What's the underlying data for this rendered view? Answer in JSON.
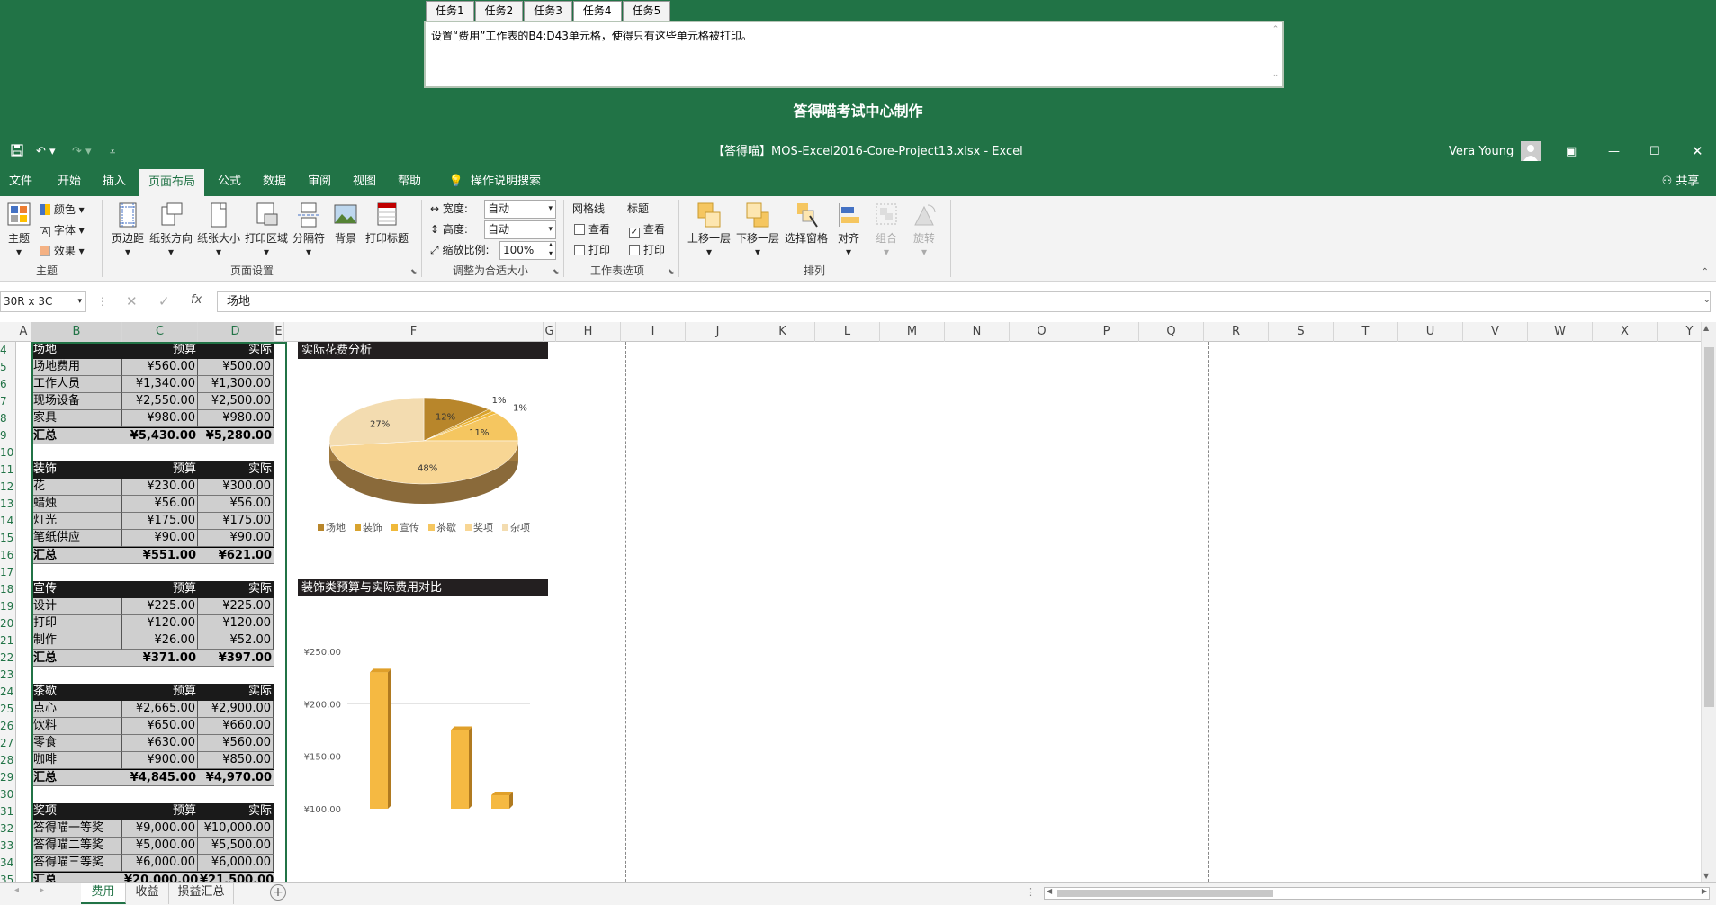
{
  "task": {
    "tabs": [
      "任务1",
      "任务2",
      "任务3",
      "任务4",
      "任务5"
    ],
    "active_tab": "任务4",
    "text": "设置“费用”工作表的B4:D43单元格，使得只有这些单元格被打印。",
    "brand": "答得喵考试中心制作"
  },
  "window": {
    "title": "【答得喵】MOS-Excel2016-Core-Project13.xlsx  -  Excel",
    "user": "Vera Young"
  },
  "menu": {
    "items": [
      "文件",
      "开始",
      "插入",
      "页面布局",
      "公式",
      "数据",
      "审阅",
      "视图",
      "帮助",
      "操作说明搜索"
    ],
    "active": "页面布局",
    "share": "共享"
  },
  "ribbon": {
    "theme": {
      "main": "主题",
      "colors": "颜色",
      "fonts": "字体",
      "effects": "效果",
      "group": "主题"
    },
    "page_setup": {
      "margins": "页边距",
      "orientation": "纸张方向",
      "size": "纸张大小",
      "print_area": "打印区域",
      "breaks": "分隔符",
      "background": "背景",
      "print_titles": "打印标题",
      "group": "页面设置"
    },
    "scale": {
      "width_label": "宽度:",
      "width_value": "自动",
      "height_label": "高度:",
      "height_value": "自动",
      "scale_label": "缩放比例:",
      "scale_value": "100%",
      "group": "调整为合适大小"
    },
    "sheet_options": {
      "gridlines": "网格线",
      "headings": "标题",
      "view": "查看",
      "print": "打印",
      "group": "工作表选项"
    },
    "arrange": {
      "forward": "上移一层",
      "backward": "下移一层",
      "selection_pane": "选择窗格",
      "align": "对齐",
      "group_btn": "组合",
      "rotate": "旋转",
      "group": "排列"
    }
  },
  "formula_bar": {
    "name_box": "30R x 3C",
    "formula": "场地",
    "fx": "fx"
  },
  "columns": [
    "A",
    "B",
    "C",
    "D",
    "E",
    "F",
    "G",
    "H",
    "I",
    "J",
    "K",
    "L",
    "M",
    "N",
    "O",
    "P",
    "Q",
    "R",
    "S",
    "T",
    "U",
    "V",
    "W",
    "X",
    "Y"
  ],
  "row_numbers": [
    "4",
    "5",
    "6",
    "7",
    "8",
    "9",
    "10",
    "11",
    "12",
    "13",
    "14",
    "15",
    "16",
    "17",
    "18",
    "19",
    "20",
    "21",
    "22",
    "23",
    "24",
    "25",
    "26",
    "27",
    "28",
    "29",
    "30",
    "31",
    "32",
    "33",
    "34",
    "35"
  ],
  "sheet_rows": [
    {
      "t": "hdr",
      "b": "场地",
      "c": "预算",
      "d": "实际"
    },
    {
      "t": "itm",
      "b": "场地费用",
      "c": "¥560.00",
      "d": "¥500.00"
    },
    {
      "t": "itm",
      "b": "工作人员",
      "c": "¥1,340.00",
      "d": "¥1,300.00"
    },
    {
      "t": "itm",
      "b": "现场设备",
      "c": "¥2,550.00",
      "d": "¥2,500.00"
    },
    {
      "t": "itm",
      "b": "家具",
      "c": "¥980.00",
      "d": "¥980.00"
    },
    {
      "t": "tot",
      "b": "汇总",
      "c": "¥5,430.00",
      "d": "¥5,280.00"
    },
    {
      "t": "blank",
      "b": "",
      "c": "",
      "d": ""
    },
    {
      "t": "hdr",
      "b": "装饰",
      "c": "预算",
      "d": "实际"
    },
    {
      "t": "itm",
      "b": "花",
      "c": "¥230.00",
      "d": "¥300.00"
    },
    {
      "t": "itm",
      "b": "蜡烛",
      "c": "¥56.00",
      "d": "¥56.00"
    },
    {
      "t": "itm",
      "b": "灯光",
      "c": "¥175.00",
      "d": "¥175.00"
    },
    {
      "t": "itm",
      "b": "笔纸供应",
      "c": "¥90.00",
      "d": "¥90.00"
    },
    {
      "t": "tot",
      "b": "汇总",
      "c": "¥551.00",
      "d": "¥621.00"
    },
    {
      "t": "blank",
      "b": "",
      "c": "",
      "d": ""
    },
    {
      "t": "hdr",
      "b": "宣传",
      "c": "预算",
      "d": "实际"
    },
    {
      "t": "itm",
      "b": "设计",
      "c": "¥225.00",
      "d": "¥225.00"
    },
    {
      "t": "itm",
      "b": "打印",
      "c": "¥120.00",
      "d": "¥120.00"
    },
    {
      "t": "itm",
      "b": "制作",
      "c": "¥26.00",
      "d": "¥52.00"
    },
    {
      "t": "tot",
      "b": "汇总",
      "c": "¥371.00",
      "d": "¥397.00"
    },
    {
      "t": "blank",
      "b": "",
      "c": "",
      "d": ""
    },
    {
      "t": "hdr",
      "b": "茶歇",
      "c": "预算",
      "d": "实际"
    },
    {
      "t": "itm",
      "b": "点心",
      "c": "¥2,665.00",
      "d": "¥2,900.00"
    },
    {
      "t": "itm",
      "b": "饮料",
      "c": "¥650.00",
      "d": "¥660.00"
    },
    {
      "t": "itm",
      "b": "零食",
      "c": "¥630.00",
      "d": "¥560.00"
    },
    {
      "t": "itm",
      "b": "咖啡",
      "c": "¥900.00",
      "d": "¥850.00"
    },
    {
      "t": "tot",
      "b": "汇总",
      "c": "¥4,845.00",
      "d": "¥4,970.00"
    },
    {
      "t": "blank",
      "b": "",
      "c": "",
      "d": ""
    },
    {
      "t": "hdr",
      "b": "奖项",
      "c": "预算",
      "d": "实际"
    },
    {
      "t": "itm",
      "b": "答得喵一等奖",
      "c": "¥9,000.00",
      "d": "¥10,000.00"
    },
    {
      "t": "itm",
      "b": "答得喵二等奖",
      "c": "¥5,000.00",
      "d": "¥5,500.00"
    },
    {
      "t": "itm",
      "b": "答得喵三等奖",
      "c": "¥6,000.00",
      "d": "¥6,000.00"
    },
    {
      "t": "tot",
      "b": "汇总",
      "c": "¥20,000.00",
      "d": "¥21,500.00"
    }
  ],
  "chart_data": [
    {
      "type": "pie",
      "title": "实际花费分析",
      "categories": [
        "场地",
        "装饰",
        "宣传",
        "茶歇",
        "奖项",
        "杂项"
      ],
      "values": [
        12,
        1,
        1,
        11,
        48,
        27
      ],
      "labels": [
        "12%",
        "1%",
        "1%",
        "11%",
        "48%",
        "27%"
      ],
      "colors": [
        "#b8862b",
        "#d8a32e",
        "#f0b93a",
        "#f5c660",
        "#f8d694",
        "#f3dcb0"
      ],
      "legend": "bottom"
    },
    {
      "type": "bar",
      "title": "装饰类预算与实际费用对比",
      "yticks": [
        "¥250.00",
        "¥200.00",
        "¥150.00",
        "¥100.00"
      ],
      "ylim": [
        100,
        250
      ],
      "values": [
        230,
        175,
        90
      ],
      "color": "#f5b942"
    }
  ],
  "sheet_tabs": [
    "费用",
    "收益",
    "损益汇总"
  ],
  "active_sheet": "费用"
}
